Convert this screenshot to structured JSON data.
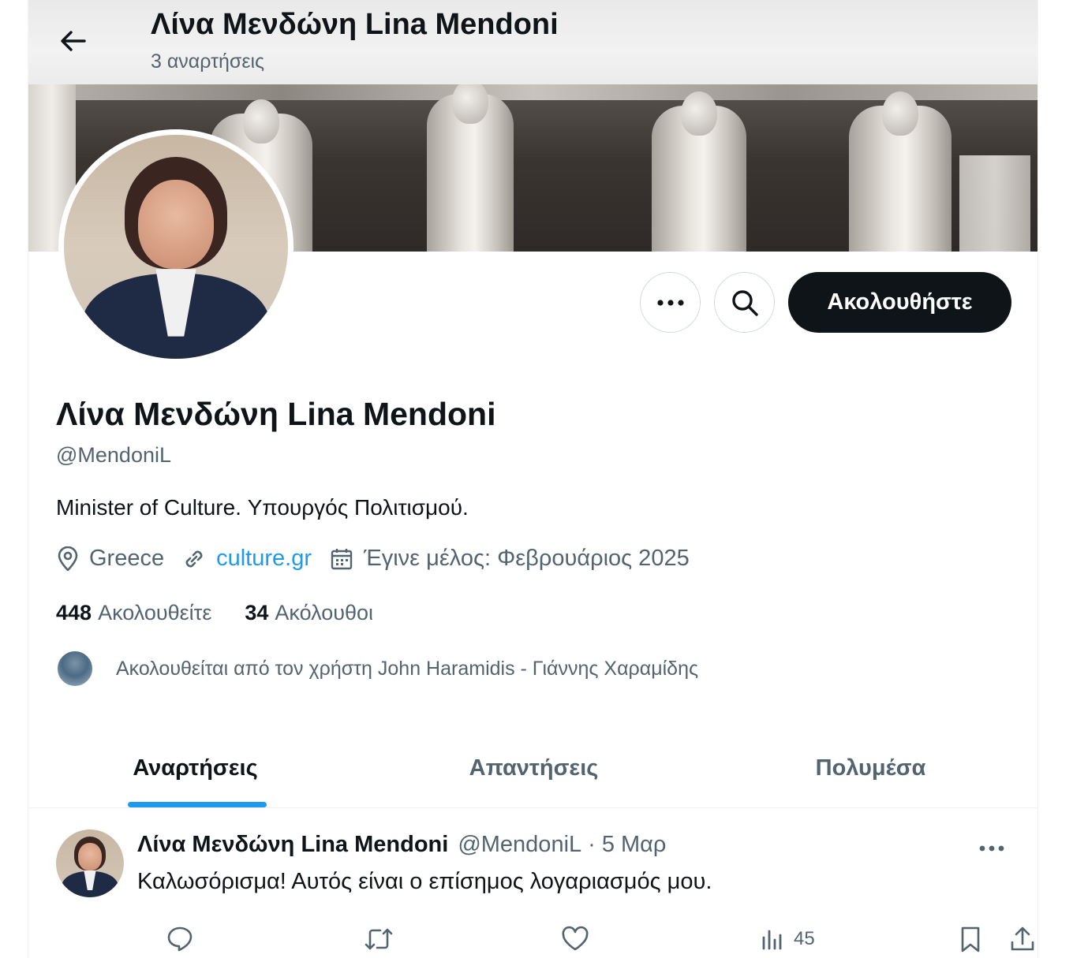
{
  "header": {
    "title": "Λίνα Μενδώνη Lina Mendoni",
    "posts_count": "3 αναρτήσεις"
  },
  "profile": {
    "name": "Λίνα Μενδώνη Lina Mendoni",
    "handle": "@MendoniL",
    "bio": "Minister of Culture. Υπουργός Πολιτισμού.",
    "location": "Greece",
    "website": "culture.gr",
    "joined": "Έγινε μέλος: Φεβρουάριος 2025",
    "following_count": "448",
    "following_label": "Ακολουθείτε",
    "followers_count": "34",
    "followers_label": "Ακόλουθοι",
    "followed_by": "Ακολουθείται από τον χρήστη John Haramidis - Γιάννης Χαραμίδης"
  },
  "actions": {
    "follow_label": "Ακολουθήστε"
  },
  "tabs": [
    {
      "label": "Αναρτήσεις",
      "active": true
    },
    {
      "label": "Απαντήσεις",
      "active": false
    },
    {
      "label": "Πολυμέσα",
      "active": false
    }
  ],
  "post": {
    "author": "Λίνα Μενδώνη Lina Mendoni",
    "handle": "@MendoniL",
    "separator": "·",
    "date": "5 Μαρ",
    "text": "Καλωσόρισμα! Αυτός είναι ο επίσημος λογαριασμός μου.",
    "views": "45"
  },
  "colors": {
    "accent": "#1d9bf0",
    "text_primary": "#0f1419",
    "text_secondary": "#536471",
    "follow_button_bg": "#0f1419"
  },
  "icons": [
    "back-arrow-icon",
    "more-icon",
    "search-icon",
    "location-icon",
    "link-icon",
    "calendar-icon",
    "reply-icon",
    "retweet-icon",
    "like-icon",
    "views-icon",
    "bookmark-icon",
    "share-icon"
  ]
}
